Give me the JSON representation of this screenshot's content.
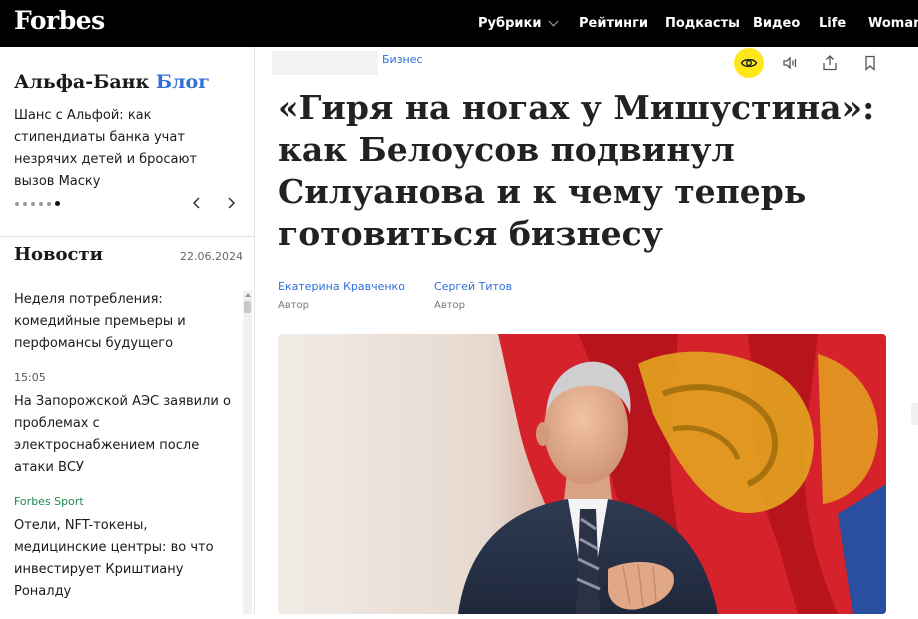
{
  "header": {
    "logo": "Forbes",
    "nav": [
      {
        "label": "Рубрики",
        "dropdown": true
      },
      {
        "label": "Рейтинги"
      },
      {
        "label": "Подкасты"
      },
      {
        "label": "Видео"
      },
      {
        "label": "Life"
      },
      {
        "label": "Woman"
      }
    ]
  },
  "sidebar": {
    "promo": {
      "brand": "Альфа-Банк",
      "brand_suffix": "Блог",
      "text": "Шанс с Альфой: как стипендиаты банка учат незрячих детей и бросают вызов Маску"
    },
    "news": {
      "title": "Новости",
      "date": "22.06.2024",
      "items": [
        {
          "time": "",
          "headline": "Неделя потребления: комедийные премьеры и перфомансы будущего"
        },
        {
          "time": "15:05",
          "headline": "На Запорожской АЭС заявили о проблемах с электроснабжением после атаки ВСУ"
        },
        {
          "time": "Forbes Sport",
          "headline": "Отели, NFT-токены, медицинские центры: во что инвестирует Криштиану Роналду"
        }
      ]
    }
  },
  "article": {
    "category": "Бизнес",
    "headline": "«Гиря на ногах у Мишустина»: как Белоусов подвинул Силуанова и к чему теперь готовиться бизнесу",
    "authors": [
      {
        "name": "Екатерина Кравченко",
        "role": "Автор"
      },
      {
        "name": "Сергей Титов",
        "role": "Автор"
      }
    ],
    "tools": [
      "eye-icon",
      "audio-icon",
      "share-icon",
      "bookmark-icon"
    ]
  },
  "colors": {
    "accent_link": "#2f6fd9",
    "highlight": "#ffe71b",
    "sport": "#1f8a4c"
  }
}
